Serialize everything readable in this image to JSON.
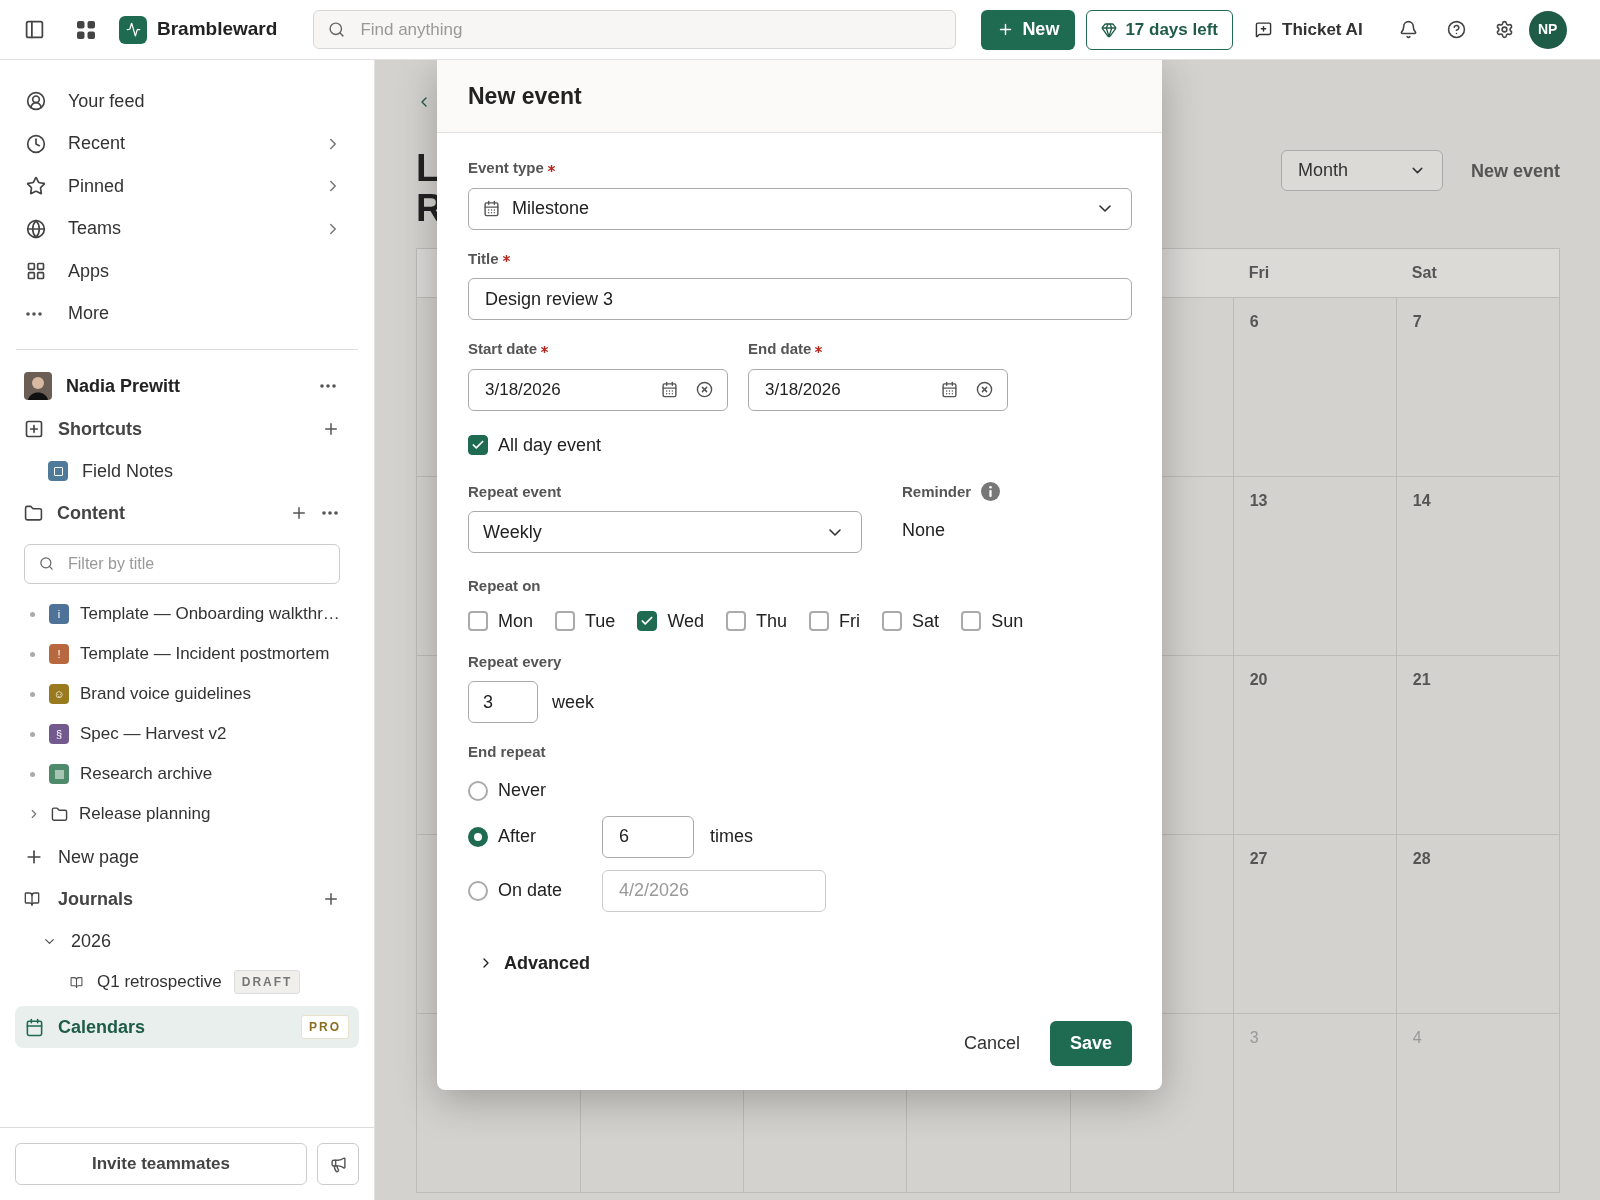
{
  "topbar": {
    "workspace": "Brambleward",
    "search_placeholder": "Find anything",
    "new_button": "New",
    "trial_button": "17 days left",
    "ai_button": "Thicket AI",
    "avatar": "NP"
  },
  "sidebar": {
    "nav": [
      {
        "label": "Your feed",
        "chevron": false
      },
      {
        "label": "Recent",
        "chevron": true
      },
      {
        "label": "Pinned",
        "chevron": true
      },
      {
        "label": "Teams",
        "chevron": true
      },
      {
        "label": "Apps",
        "chevron": false
      },
      {
        "label": "More",
        "chevron": false
      }
    ],
    "user": {
      "name": "Nadia Prewitt"
    },
    "shortcuts": {
      "label": "Shortcuts",
      "items": [
        {
          "label": "Field Notes",
          "color": "#4f7a99"
        }
      ]
    },
    "content": {
      "label": "Content",
      "filter_placeholder": "Filter by title",
      "items": [
        {
          "kind": "page",
          "label": "Template — Onboarding walkthr…",
          "color": "#4f7398",
          "glyph": "i"
        },
        {
          "kind": "page",
          "label": "Template — Incident postmortem",
          "color": "#b8683e",
          "glyph": "!"
        },
        {
          "kind": "page",
          "label": "Brand voice guidelines",
          "color": "#9a7a1e",
          "glyph": "☺"
        },
        {
          "kind": "page",
          "label": "Spec — Harvest v2",
          "color": "#735a8e",
          "glyph": "§"
        },
        {
          "kind": "page",
          "label": "Research archive",
          "color": "#4f8a6a"
        },
        {
          "kind": "folder",
          "label": "Release planning",
          "expanded": false
        }
      ]
    },
    "new_page": "New page",
    "journals": {
      "label": "Journals",
      "children": [
        {
          "label": "2026",
          "expanded": true,
          "children": [
            {
              "label": "Q1 retrospective",
              "badge": "DRAFT"
            }
          ]
        }
      ]
    },
    "calendars": {
      "label": "Calendars",
      "badge": "PRO",
      "selected": true
    },
    "invite_button": "Invite teammates"
  },
  "main": {
    "heading_lines": [
      "L",
      "R"
    ],
    "view_select": "Month",
    "new_event": "New event",
    "calendar": {
      "headers": [
        "Fri",
        "Sat"
      ],
      "rows": [
        {
          "cells": [
            {
              "text": "6",
              "muted": false
            },
            {
              "text": "7",
              "muted": false
            }
          ]
        },
        {
          "cells": [
            {
              "text": "13",
              "muted": false
            },
            {
              "text": "14",
              "muted": false
            }
          ]
        },
        {
          "cells": [
            {
              "text": "20",
              "muted": false
            },
            {
              "text": "21",
              "muted": false
            }
          ]
        },
        {
          "cells": [
            {
              "text": "27",
              "muted": false
            },
            {
              "text": "28",
              "muted": false
            }
          ]
        },
        {
          "cells": [
            {
              "text": "3",
              "muted": true
            },
            {
              "text": "4",
              "muted": true
            }
          ]
        }
      ]
    }
  },
  "modal": {
    "title": "New event",
    "event_type": {
      "label": "Event type",
      "required": true,
      "value": "Milestone"
    },
    "title_field": {
      "label": "Title",
      "required": true,
      "value": "Design review 3"
    },
    "start_date": {
      "label": "Start date",
      "required": true,
      "value": "3/18/2026"
    },
    "end_date": {
      "label": "End date",
      "required": true,
      "value": "3/18/2026"
    },
    "all_day": {
      "label": "All day event",
      "checked": true
    },
    "repeat_event": {
      "label": "Repeat event",
      "value": "Weekly"
    },
    "reminder": {
      "label": "Reminder",
      "value": "None"
    },
    "repeat_on": {
      "label": "Repeat on",
      "days": [
        {
          "label": "Mon",
          "checked": false
        },
        {
          "label": "Tue",
          "checked": false
        },
        {
          "label": "Wed",
          "checked": true
        },
        {
          "label": "Thu",
          "checked": false
        },
        {
          "label": "Fri",
          "checked": false
        },
        {
          "label": "Sat",
          "checked": false
        },
        {
          "label": "Sun",
          "checked": false
        }
      ]
    },
    "repeat_every": {
      "label": "Repeat every",
      "value": "3",
      "unit": "week"
    },
    "end_repeat": {
      "label": "End repeat",
      "options": [
        {
          "kind": "plain",
          "label": "Never",
          "selected": false
        },
        {
          "kind": "count",
          "label": "After",
          "selected": true,
          "value": "6",
          "unit": "times",
          "disabled": false
        },
        {
          "kind": "date",
          "label": "On date",
          "selected": false,
          "value": "4/2/2026",
          "disabled": true
        }
      ]
    },
    "advanced": {
      "label": "Advanced",
      "expanded": false
    },
    "cancel_button": "Cancel",
    "save_button": "Save"
  }
}
